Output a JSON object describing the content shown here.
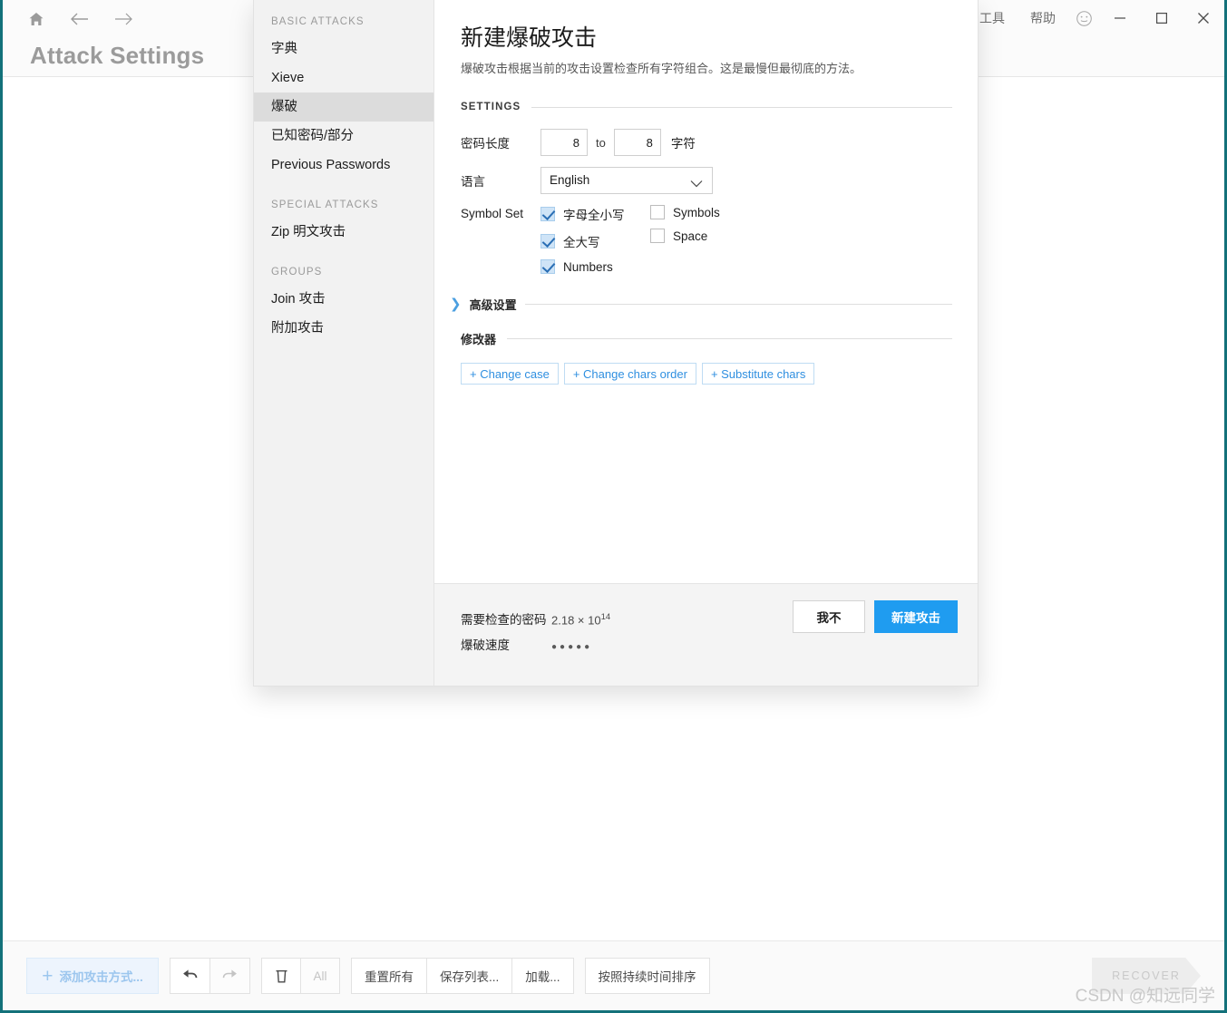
{
  "window": {
    "page_title": "Attack Settings",
    "menu": [
      {
        "label": "工具"
      },
      {
        "label": "帮助"
      }
    ],
    "icons": {
      "home": "home-icon",
      "back": "back-arrow-icon",
      "forward": "forward-arrow-icon",
      "smiley": "smiley-icon",
      "minimize": "minimize-icon",
      "maximize": "maximize-icon",
      "close": "close-icon"
    }
  },
  "dialog": {
    "sidebar": {
      "groups": [
        {
          "heading": "BASIC ATTACKS",
          "items": [
            {
              "label": "字典",
              "selected": false
            },
            {
              "label": "Xieve",
              "selected": false
            },
            {
              "label": "爆破",
              "selected": true
            },
            {
              "label": "已知密码/部分",
              "selected": false
            },
            {
              "label": "Previous Passwords",
              "selected": false
            }
          ]
        },
        {
          "heading": "SPECIAL ATTACKS",
          "items": [
            {
              "label": "Zip 明文攻击",
              "selected": false
            }
          ]
        },
        {
          "heading": "GROUPS",
          "items": [
            {
              "label": "Join 攻击",
              "selected": false
            },
            {
              "label": "附加攻击",
              "selected": false
            }
          ]
        }
      ]
    },
    "title": "新建爆破攻击",
    "subtitle": "爆破攻击根据当前的攻击设置检查所有字符组合。这是最慢但最彻底的方法。",
    "settings_heading": "SETTINGS",
    "password_length": {
      "label": "密码长度",
      "min": "8",
      "to": "to",
      "max": "8",
      "unit": "字符"
    },
    "language": {
      "label": "语言",
      "value": "English"
    },
    "symbol_set": {
      "label": "Symbol Set",
      "column1": [
        {
          "label": "字母全小写",
          "checked": true
        },
        {
          "label": "全大写",
          "checked": true
        },
        {
          "label": "Numbers",
          "checked": true
        }
      ],
      "column2": [
        {
          "label": "Symbols",
          "checked": false
        },
        {
          "label": "Space",
          "checked": false
        }
      ]
    },
    "advanced": {
      "chevron": "❯",
      "label": "高级设置"
    },
    "modifiers": {
      "label": "修改器",
      "buttons": [
        {
          "label": "+ Change case"
        },
        {
          "label": "+ Change chars order"
        },
        {
          "label": "+ Substitute chars"
        }
      ]
    },
    "footer": {
      "passwords_label": "需要检查的密码",
      "passwords_mantissa": "2.18 × 10",
      "passwords_exponent": "14",
      "speed_label": "爆破速度",
      "speed_dots": "●●●●●",
      "cancel_label": "我不",
      "confirm_label": "新建攻击"
    }
  },
  "toolbar": {
    "add_label": "添加攻击方式...",
    "add_plus": "+",
    "undo": "undo-icon",
    "redo": "redo-icon",
    "delete": "trash-icon",
    "all_label": "All",
    "reset_label": "重置所有",
    "save_label": "保存列表...",
    "load_label": "加载...",
    "sort_label": "按照持续时间排序",
    "recover_label": "RECOVER"
  },
  "watermark": "CSDN @知远同学",
  "colors": {
    "accent_blue": "#1f9cf0",
    "link_blue": "#2f8fe0",
    "window_border": "#13717a",
    "selected_item": "#dcdcdc"
  }
}
